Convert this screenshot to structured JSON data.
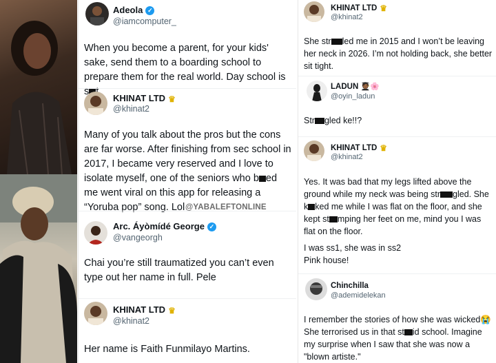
{
  "watermark": "@YABALEFTONLINE",
  "colors": {
    "verified": "#1d9bf0",
    "handle": "#536471",
    "text": "#0f1419"
  },
  "middle": [
    {
      "name": "Adeola",
      "badge": "verified-icon",
      "handle": "@iamcomputer_",
      "text_a": "When you become a parent, for your kids' sake, send them to a boarding school to prepare them for the real world. Day school is s",
      "text_b": "t."
    },
    {
      "name": "KHINAT LTD",
      "badge": "crown-icon",
      "handle": "@khinat2",
      "text_a": "Many of you talk about the pros but the cons are far worse. After finishing from sec school in 2017, I became very reserved and I love to isolate myself, one of the seniors who b",
      "text_b": "ed me went viral on this app for releasing a “Yoruba pop” song. Lol"
    },
    {
      "name": "Arc. Áyòmídé George",
      "badge": "verified-icon",
      "handle": "@vangeorgh",
      "text": "Chai you’re still traumatized you can’t even type out her name in full. Pele"
    },
    {
      "name": "KHINAT LTD",
      "badge": "crown-icon",
      "handle": "@khinat2",
      "text": "Her name is Faith Funmilayo Martins."
    }
  ],
  "right": [
    {
      "name": "KHINAT LTD",
      "handle": "@khinat2",
      "text_a": "She str",
      "text_b": "led me in 2015 and I won’t be leaving her neck in 2026. I’m not holding back, she better sit tight."
    },
    {
      "name": "LADUN",
      "emoji": "🧑🏾‍🎓🌸",
      "handle": "@oyin_ladun",
      "text_a": "Str",
      "text_b": "gled ke!!?"
    },
    {
      "name": "KHINAT LTD",
      "handle": "@khinat2",
      "p1_a": "Yes. It was bad that my legs lifted above the ground while my neck was being str",
      "p1_b": "gled. She k",
      "p1_c": "ked me while I was flat on the floor, and she kept st",
      "p1_d": "mping her feet on me, mind you I was flat on the floor.",
      "p2_line1": "I was ss1, she was in ss2",
      "p2_line2": "Pink house!"
    },
    {
      "name": "Chinchilla",
      "handle": "@ademidelekan",
      "text_a": "I remember the stories of how she was wicked😭 She terrorised us in that st",
      "text_b": "id school. Imagine my surprise when I saw that she was now a \"blown artiste.\""
    }
  ]
}
